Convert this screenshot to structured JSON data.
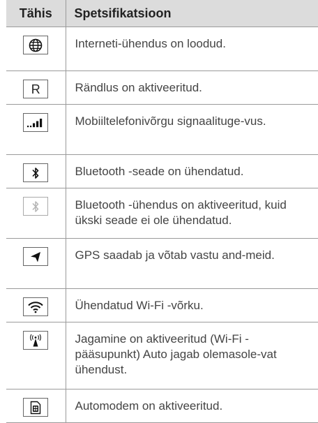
{
  "header": {
    "col1": "Tähis",
    "col2": "Spetsifikatsioon"
  },
  "rows": [
    {
      "icon": "globe-icon",
      "text": "Interneti-ühendus on loodud."
    },
    {
      "icon": "roaming-r-icon",
      "glyph": "R",
      "text": "Rändlus on aktiveeritud."
    },
    {
      "icon": "signal-strength-icon",
      "text": "Mobiiltelefonivõrgu signaalituge-vus."
    },
    {
      "icon": "bluetooth-icon",
      "text": "Bluetooth -seade on ühendatud."
    },
    {
      "icon": "bluetooth-inactive-icon",
      "text": "Bluetooth -ühendus on aktiveeritud, kuid ükski seade ei ole ühendatud."
    },
    {
      "icon": "gps-arrow-icon",
      "text": "GPS saadab ja võtab vastu and-meid."
    },
    {
      "icon": "wifi-icon",
      "text": "Ühendatud Wi-Fi -võrku."
    },
    {
      "icon": "hotspot-icon",
      "text": "Jagamine on aktiveeritud (Wi-Fi -pääsupunkt) Auto jagab olemasole-vat ühendust."
    },
    {
      "icon": "modem-sim-icon",
      "text": "Automodem on aktiveeritud."
    }
  ]
}
